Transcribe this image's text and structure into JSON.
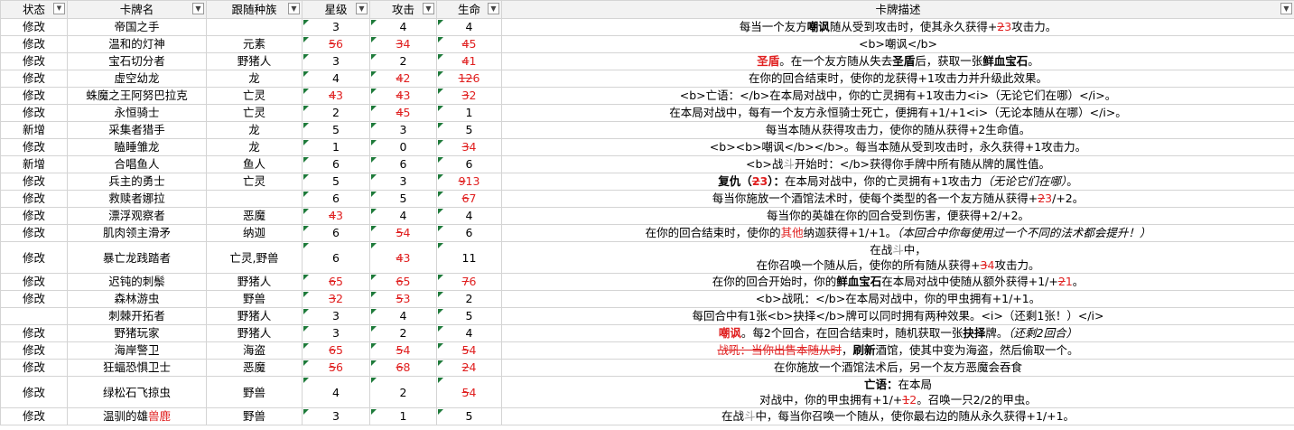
{
  "headers": {
    "status": "状态",
    "name": "卡牌名",
    "tribe": "跟随种族",
    "star": "星级",
    "attack": "攻击",
    "health": "生命",
    "desc": "卡牌描述"
  },
  "rows": [
    {
      "status": "修改",
      "name": "帝国之手",
      "tribe": "",
      "star": "3",
      "atk": "4",
      "hp": "4",
      "desc_a": "每当一个友方",
      "desc_b": "嘲讽",
      "desc_c": "随从受到攻击时，使其永久获得+",
      "desc_old": "2",
      "desc_new": "3",
      "desc_d": "攻击力。"
    },
    {
      "status": "修改",
      "name": "温和的灯神",
      "tribe": "元素",
      "star_old": "5",
      "star_new": "6",
      "atk_old": "3",
      "atk_new": "4",
      "hp_old": "4",
      "hp_new": "5",
      "desc": "<b>嘲讽</b>"
    },
    {
      "status": "修改",
      "name": "宝石切分者",
      "tribe": "野猪人",
      "star": "3",
      "atk": "2",
      "hp_old": "4",
      "hp_new": "1",
      "desc_a": "圣盾",
      "desc_b": "。在一个友方随从失去",
      "desc_c": "圣盾",
      "desc_d": "后，获取一张",
      "desc_e": "鲜血宝石",
      "desc_f": "。"
    },
    {
      "status": "修改",
      "name": "虚空幼龙",
      "tribe": "龙",
      "star": "4",
      "atk_old": "4",
      "atk_new": "2",
      "hp_old": "1",
      "hp_new": "2",
      "hp_new2": "6",
      "desc": "在你的回合结束时，使你的龙获得+1攻击力并升级此效果。"
    },
    {
      "status": "修改",
      "name": "蛛魔之王阿努巴拉克",
      "tribe": "亡灵",
      "star_old": "4",
      "star_new": "3",
      "atk_old": "4",
      "atk_new": "3",
      "hp_old": "3",
      "hp_new": "2",
      "desc": "<b>亡语：</b>在本局对战中，你的亡灵拥有+1攻击力<i>（无论它们在哪）</i>。"
    },
    {
      "status": "修改",
      "name": "永恒骑士",
      "tribe": "亡灵",
      "star": "2",
      "atk_old": "4",
      "atk_new": "5",
      "hp": "1",
      "desc": "在本局对战中，每有一个友方永恒骑士死亡，便拥有+1/+1<i>（无论本随从在哪）</i>。"
    },
    {
      "status": "新增",
      "name": "采集者猎手",
      "tribe": "龙",
      "star": "5",
      "atk": "3",
      "hp": "5",
      "desc": "每当本随从获得攻击力，使你的随从获得+2生命值。"
    },
    {
      "status": "修改",
      "name": "瞌睡雏龙",
      "tribe": "龙",
      "star": "1",
      "atk": "0",
      "hp_old": "3",
      "hp_new": "4",
      "desc": "<b><b>嘲讽</b></b>。每当本随从受到攻击时，永久获得+1攻击力。"
    },
    {
      "status": "新增",
      "name": "合唱鱼人",
      "tribe": "鱼人",
      "star": "6",
      "atk": "6",
      "hp": "6",
      "desc_a": "<b>战",
      "desc_b": "斗",
      "desc_c": "开始时：</b>获得你手牌中所有随从牌的属性值。"
    },
    {
      "status": "修改",
      "name": "兵主的勇士",
      "tribe": "亡灵",
      "star": "5",
      "atk": "3",
      "hp_old": "9",
      "hp_new": "13",
      "desc_a": "复仇（",
      "desc_b": "2",
      "desc_c": "3",
      "desc_d": "）：",
      "desc_e": "在本局对战中，你的亡灵拥有+1攻击力",
      "desc_f": "（无论它们在哪）",
      "desc_g": "。"
    },
    {
      "status": "修改",
      "name": "救赎者娜拉",
      "tribe": "",
      "star": "6",
      "atk": "5",
      "hp_old": "6",
      "hp_new": "7",
      "desc_a": "每当你施放一个酒馆法术时，使每个类型的各一个友方随从获得+",
      "desc_old": "2",
      "desc_new": "3",
      "desc_b": "/+2。"
    },
    {
      "status": "修改",
      "name": "漂浮观察者",
      "tribe": "恶魔",
      "star_old": "4",
      "star_new": "3",
      "atk": "4",
      "hp": "4",
      "desc": "每当你的英雄在你的回合受到伤害，便获得+2/+2。"
    },
    {
      "status": "修改",
      "name": "肌肉领主滑矛",
      "tribe": "纳迦",
      "star": "6",
      "atk_old": "5",
      "atk_new": "4",
      "hp": "6",
      "desc_a": "在你的回合结束时，使你的",
      "desc_b": "其他",
      "desc_c": "纳迦获得+1/+1。",
      "desc_d": "（本回合中你每使用过一个不同的法术都会提升！）"
    },
    {
      "status": "修改",
      "name": "暴亡龙践踏者",
      "tribe": "亡灵,野兽",
      "star": "6",
      "atk_old": "4",
      "atk_new": "3",
      "hp": "11",
      "desc_l1a": "在战",
      "desc_l1b": "斗",
      "desc_l1c": "中，",
      "desc_l2a": "在你召唤一个随从后，使你的所有随从获得+",
      "desc_l2old": "3",
      "desc_l2new": "4",
      "desc_l2b": "攻击力。"
    },
    {
      "status": "修改",
      "name": "迟钝的刺鬃",
      "tribe": "野猪人",
      "star_old": "6",
      "star_new": "5",
      "atk_old": "6",
      "atk_new": "5",
      "hp_old": "7",
      "hp_new": "6",
      "desc_a": "在你的回合开始时，你的",
      "desc_b": "鲜血宝石",
      "desc_c": "在本局对战中使随从额外获得+1/+",
      "desc_old": "2",
      "desc_new": "1",
      "desc_d": "。"
    },
    {
      "status": "修改",
      "name": "森林游虫",
      "tribe": "野兽",
      "star_old": "3",
      "star_new": "2",
      "atk_old": "5",
      "atk_new": "3",
      "hp": "2",
      "desc": "<b>战吼：</b>在本局对战中，你的甲虫拥有+1/+1。"
    },
    {
      "status": "",
      "name": "刺棘开拓者",
      "tribe": "野猪人",
      "star": "3",
      "atk": "4",
      "hp": "5",
      "desc": "每回合中有1张<b>抉择</b>牌可以同时拥有两种效果。<i>（还剩1张！）</i>"
    },
    {
      "status": "修改",
      "name": "野猪玩家",
      "tribe": "野猪人",
      "star": "3",
      "atk": "2",
      "hp": "4",
      "desc_a": "嘲讽",
      "desc_b": "。每2个回合，在回合结束时，随机获取一张",
      "desc_c": "抉择",
      "desc_d": "牌。",
      "desc_e": "（还剩2回合）"
    },
    {
      "status": "修改",
      "name": "海岸警卫",
      "tribe": "海盗",
      "star_old": "6",
      "star_new": "5",
      "atk_old": "5",
      "atk_new": "4",
      "hp_old": "5",
      "hp_new": "4",
      "desc_a": "战吼：当你出售本随从时",
      "desc_b": "，",
      "desc_c": "刷新",
      "desc_d": "酒馆，使其中变为海盗，然后偷取一个。"
    },
    {
      "status": "修改",
      "name": "狂蝠恐惧卫士",
      "tribe": "恶魔",
      "star_old": "5",
      "star_new": "6",
      "atk_old": "6",
      "atk_new": "8",
      "hp_old": "2",
      "hp_new": "4",
      "desc": "在你施放一个酒馆法术后，另一个友方恶魔会吞食"
    },
    {
      "status": "修改",
      "name": "绿松石飞掠虫",
      "tribe": "野兽",
      "star": "4",
      "atk": "2",
      "hp_old": "5",
      "hp_new": "4",
      "desc_l1a": "亡语：",
      "desc_l1b": "在本局",
      "desc_l2a": "对战中，你的甲虫拥有+1/+",
      "desc_l2old": "1",
      "desc_l2new": "2",
      "desc_l2b": "。召唤一只2/2的甲虫。"
    },
    {
      "status": "修改",
      "name_a": "温驯的雄",
      "name_b": "兽鹿",
      "tribe": "野兽",
      "star": "3",
      "atk": "1",
      "hp": "5",
      "desc_a": "在战",
      "desc_b": "斗",
      "desc_c": "中，每当你召唤一个随从，使你最右边的随从永久获得+1/+1。"
    }
  ]
}
